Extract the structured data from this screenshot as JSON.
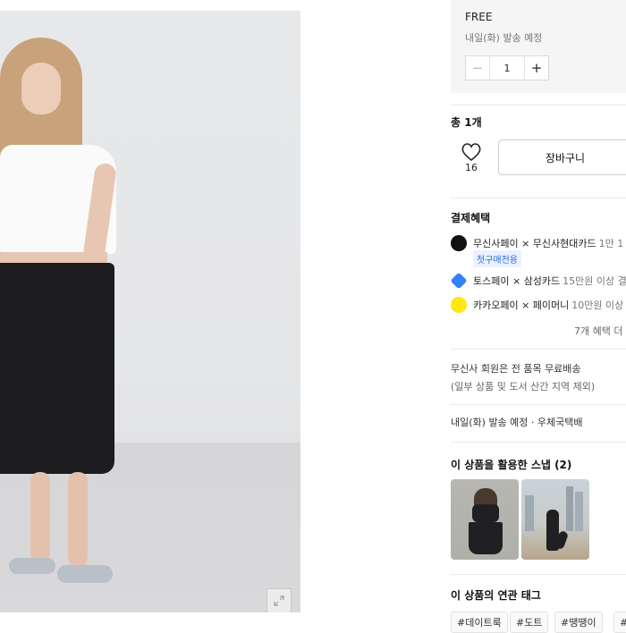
{
  "product": {
    "image_alt": "model wearing white cap-sleeve top and black long skirt",
    "expand_icon": "expand-icon"
  },
  "option": {
    "name": "FREE",
    "shipping": "내일(화) 발송 예정",
    "quantity": "1",
    "minus": "−",
    "plus": "+"
  },
  "summary": {
    "total_label": "총 1개",
    "like_count": "16",
    "cart_label": "장바구니"
  },
  "payment": {
    "title": "결제혜택",
    "items": [
      {
        "label": "무신사페이 × 무신사현대카드",
        "detail": "1만 1",
        "logo_color": "#111111"
      },
      {
        "label": "토스페이 × 삼성카드",
        "detail": "15만원 이상 결",
        "logo_color": "#3182f6"
      },
      {
        "label": "카카오페이 × 페이머니",
        "detail": "10만원 이상",
        "logo_color": "#ffe812"
      }
    ],
    "first_purchase_badge": "첫구매전용",
    "more_label": "7개 혜택 더"
  },
  "delivery": {
    "free_shipping": "무신사 회원은 전 품목 무료배송",
    "exception": "(일부 상품 및 도서 산간 지역 제외)",
    "schedule": "내일(화) 발송 예정 · 우체국택배"
  },
  "snaps": {
    "title": "이 상품을 활용한 스냅 (2)"
  },
  "tags": {
    "title": "이 상품의 연관 태그",
    "items": [
      "#데이트룩",
      "#도트",
      "#땡땡이",
      "#마"
    ]
  }
}
